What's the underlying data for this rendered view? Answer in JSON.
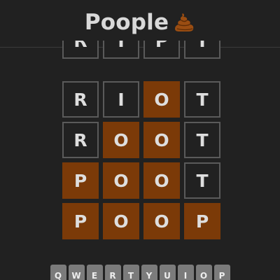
{
  "header": {
    "title": "Poople",
    "logo_icon": "poop-emoji-icon"
  },
  "colors": {
    "background": "#212121",
    "tile_border": "#5a5a5a",
    "tile_present": "#7b3a08",
    "key_background": "#7b7b7b",
    "text": "#dedede"
  },
  "board": {
    "rows": [
      {
        "tiles": [
          {
            "letter": "R",
            "state": "absent"
          },
          {
            "letter": "I",
            "state": "absent"
          },
          {
            "letter": "P",
            "state": "absent"
          },
          {
            "letter": "T",
            "state": "absent"
          }
        ]
      },
      {
        "tiles": [
          {
            "letter": "R",
            "state": "absent"
          },
          {
            "letter": "I",
            "state": "absent"
          },
          {
            "letter": "O",
            "state": "present"
          },
          {
            "letter": "T",
            "state": "absent"
          }
        ]
      },
      {
        "tiles": [
          {
            "letter": "R",
            "state": "absent"
          },
          {
            "letter": "O",
            "state": "present"
          },
          {
            "letter": "O",
            "state": "present"
          },
          {
            "letter": "T",
            "state": "absent"
          }
        ]
      },
      {
        "tiles": [
          {
            "letter": "P",
            "state": "present"
          },
          {
            "letter": "O",
            "state": "present"
          },
          {
            "letter": "O",
            "state": "present"
          },
          {
            "letter": "T",
            "state": "absent"
          }
        ]
      },
      {
        "tiles": [
          {
            "letter": "P",
            "state": "present"
          },
          {
            "letter": "O",
            "state": "present"
          },
          {
            "letter": "O",
            "state": "present"
          },
          {
            "letter": "P",
            "state": "present"
          }
        ]
      }
    ]
  },
  "keyboard": {
    "row1": [
      "Q",
      "W",
      "E",
      "R",
      "T",
      "Y",
      "U",
      "I",
      "O",
      "P"
    ]
  }
}
